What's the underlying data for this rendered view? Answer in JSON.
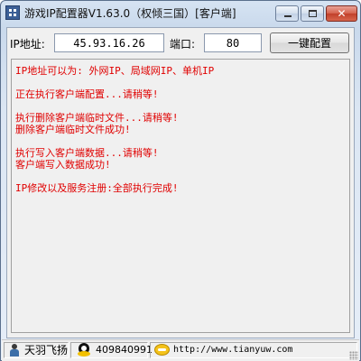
{
  "window": {
    "title": "游戏IP配置器V1.63.0（权倾三国）[客户端]",
    "close_glyph": "✕"
  },
  "form": {
    "ip_label": "IP地址:",
    "ip_value": "45.93.16.26",
    "port_label": "端口:",
    "port_value": "80",
    "config_button_label": "一键配置"
  },
  "log": {
    "lines": [
      "IP地址可以为:  外网IP、局域网IP、单机IP",
      "",
      "正在执行客户端配置...请稍等!",
      "",
      "执行删除客户端临时文件...请稍等!",
      "删除客户端临时文件成功!",
      "",
      "执行写入客户端数据...请稍等!",
      "客户端写入数据成功!",
      "",
      "IP修改以及服务注册:全部执行完成!"
    ]
  },
  "statusbar": {
    "author": "天羽飞扬",
    "qq": "409840991",
    "website": "http://www.tianyuw.com"
  },
  "colors": {
    "log_text": "#e00000",
    "title_gradient_top": "#d6e3f2",
    "close_button": "#c1402a"
  },
  "icons": {
    "app": "app-icon",
    "minimize": "minimize-icon",
    "maximize": "maximize-icon",
    "close": "close-icon",
    "author": "person-icon",
    "qq": "qq-penguin-icon",
    "chat": "chat-bubble-icon"
  }
}
